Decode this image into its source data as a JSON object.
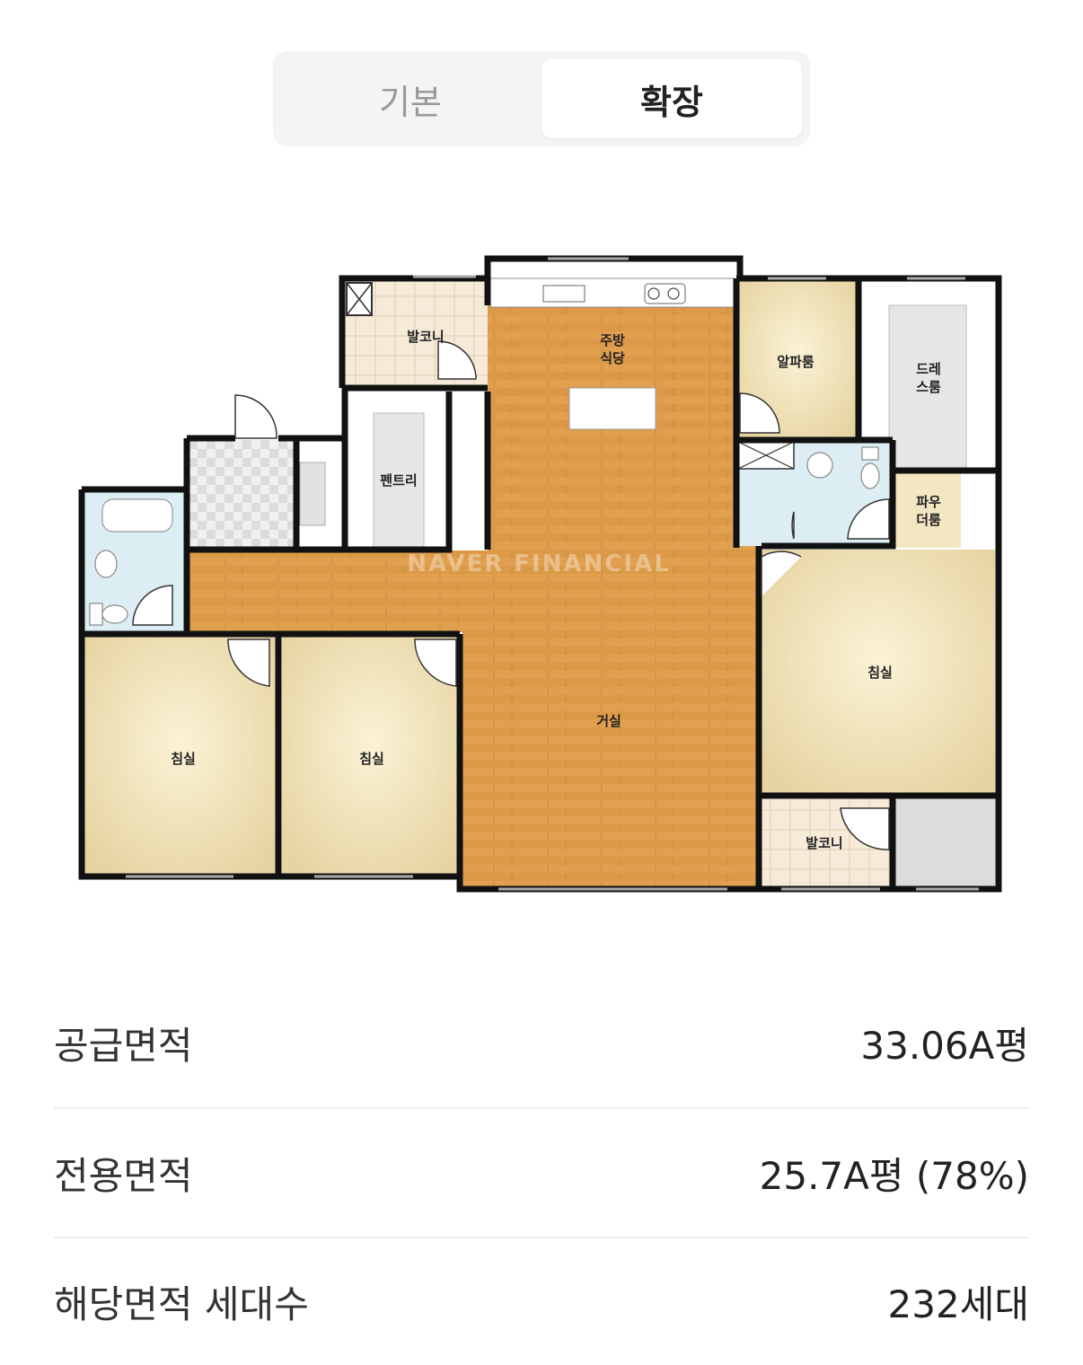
{
  "tabs": {
    "basic": "기본",
    "extended": "확장",
    "selected": "확장"
  },
  "floorplan": {
    "watermark": "NAVER FINANCIAL",
    "rooms": {
      "balcony_top": "발코니",
      "kitchen_line1": "주방",
      "kitchen_line2": "식당",
      "alpha_room": "알파룸",
      "dress_line1": "드레",
      "dress_line2": "스룸",
      "pantry": "펜트리",
      "powder_line1": "파우",
      "powder_line2": "더룸",
      "living": "거실",
      "bedroom_master": "침실",
      "bedroom_left": "침실",
      "bedroom_middle": "침실",
      "balcony_bottom": "발코니"
    }
  },
  "info": {
    "supply_area_label": "공급면적",
    "supply_area_value": "33.06A평",
    "exclusive_area_label": "전용면적",
    "exclusive_area_value": "25.7A평 (78%)",
    "households_label": "해당면적 세대수",
    "households_value": "232세대"
  }
}
